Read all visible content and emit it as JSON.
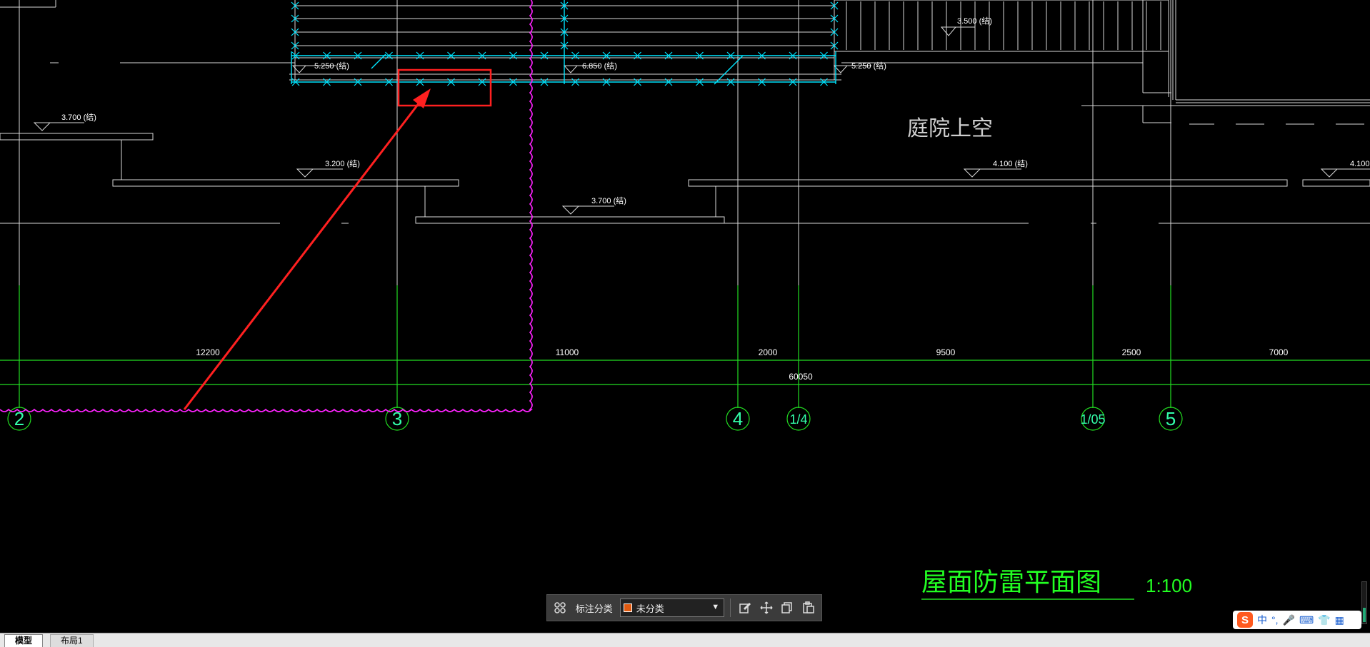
{
  "drawing": {
    "courtyard_label": "庭院上空",
    "title": "屋面防雷平面图",
    "scale": "1:100",
    "elevations": [
      "3.500 (结)",
      "5.250 (结)",
      "6.850 (结)",
      "5.250 (结)",
      "3.700 (结)",
      "3.200 (结)",
      "3.700 (结)",
      "4.100 (结)",
      "4.100"
    ],
    "dimensions": [
      "12200",
      "11000",
      "2000",
      "9500",
      "2500",
      "7000"
    ],
    "total_dimension": "60050",
    "axes": [
      "2",
      "3",
      "4",
      "1/4",
      "1/05",
      "5"
    ]
  },
  "toolbar": {
    "label": "标注分类",
    "category": "未分类",
    "category_color": "#e05a10"
  },
  "tabs": [
    "模型",
    "布局1"
  ],
  "ime": {
    "logo": "S",
    "lang": "中",
    "punct": "°,",
    "mic": "🎤",
    "keyboard": "⌨",
    "skin": "👕",
    "grid": "▦"
  },
  "colors": {
    "background": "#000000",
    "axis_green": "#22dd22",
    "lightning_cyan": "#00e5ff",
    "cloud_magenta": "#ff22ff",
    "annotation_red": "#ff2020"
  }
}
